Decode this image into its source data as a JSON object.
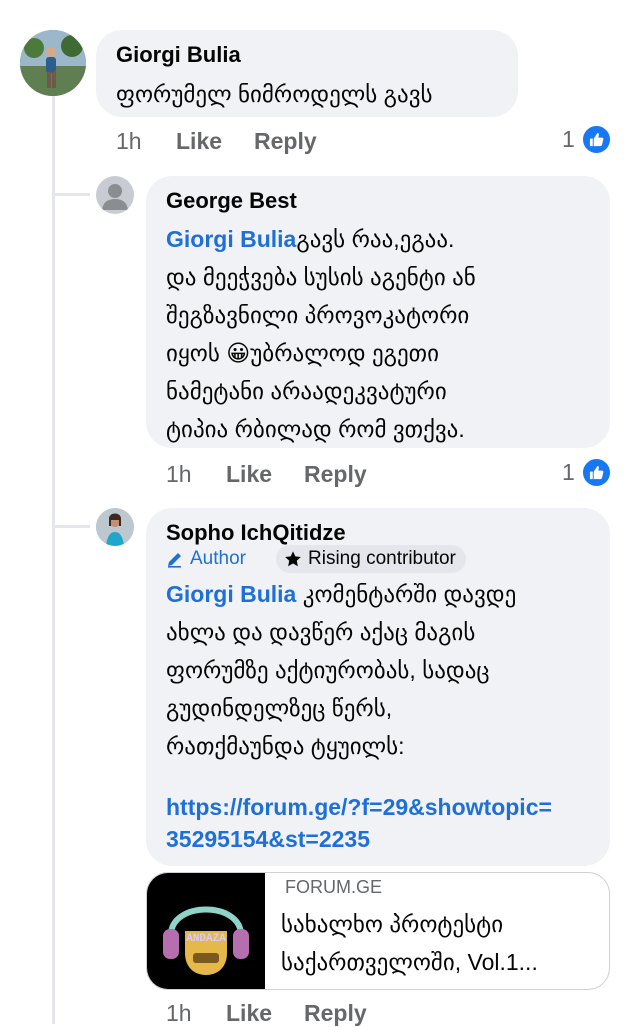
{
  "comments": [
    {
      "author": "Giorgi Bulia",
      "text": "ფორუმელ ნიმროდელს გავს",
      "time": "1h",
      "like_label": "Like",
      "reply_label": "Reply",
      "reaction_count": "1"
    },
    {
      "author": "George Best",
      "mention": "Giorgi Bulia",
      "text_lines": [
        "გავს რაა,ეგაა.",
        "და მეეჭვება სუსის აგენტი ან",
        "შეგზავნილი პროვოკატორი",
        "იყოს",
        "უბრალოდ ეგეთი",
        "ნამეტანი არაადეკვატური",
        "ტიპია რბილად რომ ვთქვა."
      ],
      "emoji": "😀",
      "time": "1h",
      "like_label": "Like",
      "reply_label": "Reply",
      "reaction_count": "1"
    },
    {
      "author": "Sopho IchQitidze",
      "badge_author": "Author",
      "badge_contributor": "Rising contributor",
      "mention": "Giorgi Bulia",
      "text_lines": [
        "კომენტარში დავდე",
        "ახლა და დავწერ აქაც მაგის",
        "ფორუმზე აქტიურობას, სადაც",
        "გუდინდელზეც წერს,",
        "რათქმაუნდა ტყუილს:"
      ],
      "link_lines": [
        "https://forum.ge/?f=29&showtopic=",
        "35295154&st=2235"
      ],
      "preview": {
        "domain": "FORUM.GE",
        "title_lines": [
          "სახალხო პროტესტი",
          "საქართველოში, Vol.1..."
        ],
        "image_text": "ANDAZA"
      },
      "time": "1h",
      "like_label": "Like",
      "reply_label": "Reply"
    }
  ],
  "colors": {
    "accent": "#1877f2",
    "mention": "#1f6fd8",
    "bubble": "#f0f2f5",
    "meta": "#65676b"
  }
}
